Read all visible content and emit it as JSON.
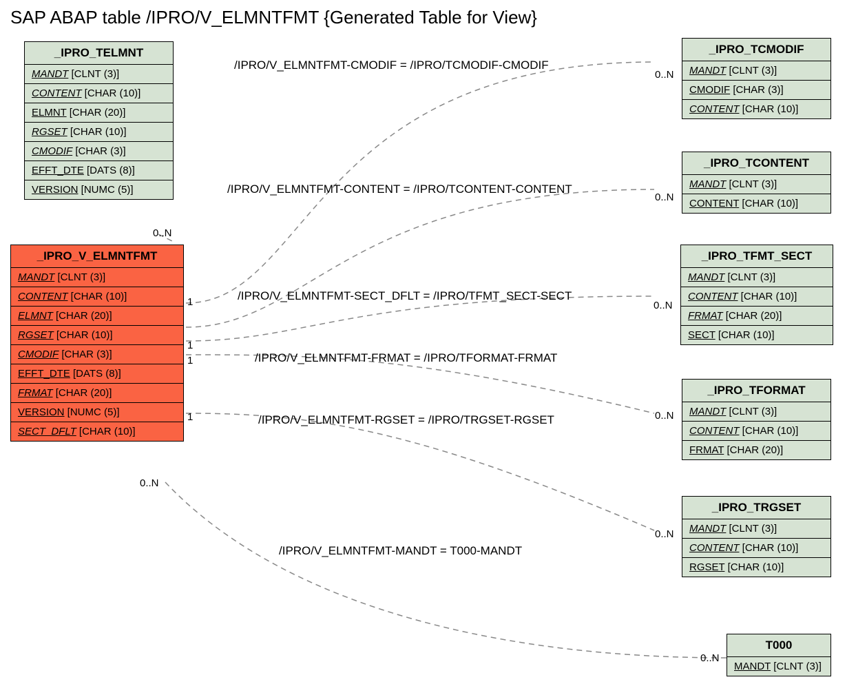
{
  "title": "SAP ABAP table /IPRO/V_ELMNTFMT {Generated Table for View}",
  "entities": {
    "telmnt": {
      "header": "_IPRO_TELMNT",
      "rows": [
        {
          "name": "MANDT",
          "type": " [CLNT (3)]",
          "italic": true
        },
        {
          "name": "CONTENT",
          "type": " [CHAR (10)]",
          "italic": true
        },
        {
          "name": "ELMNT",
          "type": " [CHAR (20)]",
          "italic": false
        },
        {
          "name": "RGSET",
          "type": " [CHAR (10)]",
          "italic": true
        },
        {
          "name": "CMODIF",
          "type": " [CHAR (3)]",
          "italic": true
        },
        {
          "name": "EFFT_DTE",
          "type": " [DATS (8)]",
          "italic": false
        },
        {
          "name": "VERSION",
          "type": " [NUMC (5)]",
          "italic": false
        }
      ]
    },
    "velmntfmt": {
      "header": "_IPRO_V_ELMNTFMT",
      "rows": [
        {
          "name": "MANDT",
          "type": " [CLNT (3)]",
          "italic": true
        },
        {
          "name": "CONTENT",
          "type": " [CHAR (10)]",
          "italic": true
        },
        {
          "name": "ELMNT",
          "type": " [CHAR (20)]",
          "italic": true
        },
        {
          "name": "RGSET",
          "type": " [CHAR (10)]",
          "italic": true
        },
        {
          "name": "CMODIF",
          "type": " [CHAR (3)]",
          "italic": true
        },
        {
          "name": "EFFT_DTE",
          "type": " [DATS (8)]",
          "italic": false
        },
        {
          "name": "FRMAT",
          "type": " [CHAR (20)]",
          "italic": true
        },
        {
          "name": "VERSION",
          "type": " [NUMC (5)]",
          "italic": false
        },
        {
          "name": "SECT_DFLT",
          "type": " [CHAR (10)]",
          "italic": true
        }
      ]
    },
    "tcmodif": {
      "header": "_IPRO_TCMODIF",
      "rows": [
        {
          "name": "MANDT",
          "type": " [CLNT (3)]",
          "italic": true
        },
        {
          "name": "CMODIF",
          "type": " [CHAR (3)]",
          "italic": false
        },
        {
          "name": "CONTENT",
          "type": " [CHAR (10)]",
          "italic": true
        }
      ]
    },
    "tcontent": {
      "header": "_IPRO_TCONTENT",
      "rows": [
        {
          "name": "MANDT",
          "type": " [CLNT (3)]",
          "italic": true
        },
        {
          "name": "CONTENT",
          "type": " [CHAR (10)]",
          "italic": false
        }
      ]
    },
    "tfmtsect": {
      "header": "_IPRO_TFMT_SECT",
      "rows": [
        {
          "name": "MANDT",
          "type": " [CLNT (3)]",
          "italic": true
        },
        {
          "name": "CONTENT",
          "type": " [CHAR (10)]",
          "italic": true
        },
        {
          "name": "FRMAT",
          "type": " [CHAR (20)]",
          "italic": true
        },
        {
          "name": "SECT",
          "type": " [CHAR (10)]",
          "italic": false
        }
      ]
    },
    "tformat": {
      "header": "_IPRO_TFORMAT",
      "rows": [
        {
          "name": "MANDT",
          "type": " [CLNT (3)]",
          "italic": true
        },
        {
          "name": "CONTENT",
          "type": " [CHAR (10)]",
          "italic": true
        },
        {
          "name": "FRMAT",
          "type": " [CHAR (20)]",
          "italic": false
        }
      ]
    },
    "trgset": {
      "header": "_IPRO_TRGSET",
      "rows": [
        {
          "name": "MANDT",
          "type": " [CLNT (3)]",
          "italic": true
        },
        {
          "name": "CONTENT",
          "type": " [CHAR (10)]",
          "italic": true
        },
        {
          "name": "RGSET",
          "type": " [CHAR (10)]",
          "italic": false
        }
      ]
    },
    "t000": {
      "header": "T000",
      "rows": [
        {
          "name": "MANDT",
          "type": " [CLNT (3)]",
          "italic": false
        }
      ]
    }
  },
  "relations": {
    "r1": "/IPRO/V_ELMNTFMT-CMODIF = /IPRO/TCMODIF-CMODIF",
    "r2": "/IPRO/V_ELMNTFMT-CONTENT = /IPRO/TCONTENT-CONTENT",
    "r3": "/IPRO/V_ELMNTFMT-SECT_DFLT = /IPRO/TFMT_SECT-SECT",
    "r4": "/IPRO/V_ELMNTFMT-FRMAT = /IPRO/TFORMAT-FRMAT",
    "r5": "/IPRO/V_ELMNTFMT-RGSET = /IPRO/TRGSET-RGSET",
    "r6": "/IPRO/V_ELMNTFMT-MANDT = T000-MANDT"
  },
  "cards": {
    "c_top_0n": "0..N",
    "c_bot_0n": "0..N",
    "c1_1": "1",
    "c2_1": "1",
    "c3_1": "1",
    "c4_1": "1",
    "rc1": "0..N",
    "rc2": "0..N",
    "rc3": "0..N",
    "rc4": "0..N",
    "rc5": "0..N",
    "rc6": "0..N"
  }
}
